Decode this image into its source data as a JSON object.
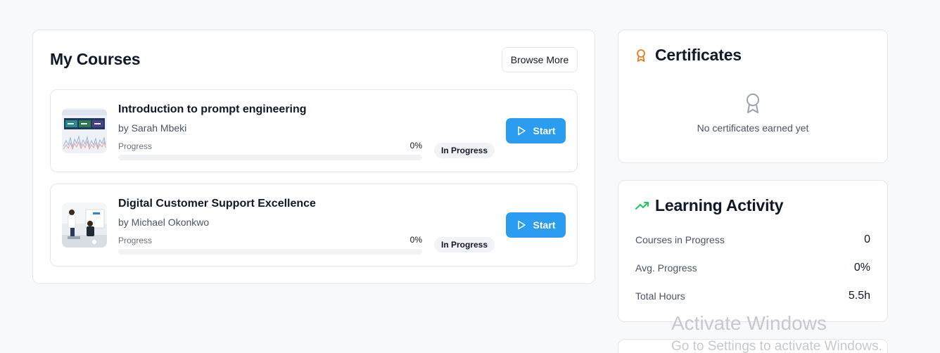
{
  "my_courses": {
    "title": "My Courses",
    "browse_label": "Browse More",
    "courses": [
      {
        "title": "Introduction to prompt engineering",
        "author": "by Sarah Mbeki",
        "progress_label": "Progress",
        "progress_text": "0%",
        "progress_value": 0,
        "status": "In Progress",
        "start_label": "Start",
        "thumbnail": "analytics-dashboard-image"
      },
      {
        "title": "Digital Customer Support Excellence",
        "author": "by Michael Okonkwo",
        "progress_label": "Progress",
        "progress_text": "0%",
        "progress_value": 0,
        "status": "In Progress",
        "start_label": "Start",
        "thumbnail": "office-meeting-image"
      }
    ]
  },
  "certificates": {
    "title": "Certificates",
    "icon": "award-icon",
    "empty_icon": "award-icon",
    "empty_text": "No certificates earned yet"
  },
  "learning_activity": {
    "title": "Learning Activity",
    "icon": "trending-up-icon",
    "stats": [
      {
        "label": "Courses in Progress",
        "value": "0"
      },
      {
        "label": "Avg. Progress",
        "value": "0%"
      },
      {
        "label": "Total Hours",
        "value": "5.5h"
      }
    ]
  },
  "watermark": {
    "title": "Activate Windows",
    "subtitle": "Go to Settings to activate Windows."
  },
  "colors": {
    "accent": "#2b9df0",
    "certificate_icon": "#ea7b1c",
    "activity_icon": "#22c55e",
    "empty_icon": "#9ca3af"
  }
}
